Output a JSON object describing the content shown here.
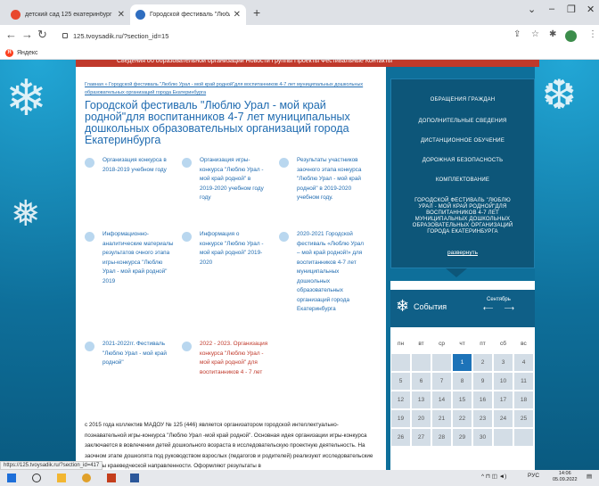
{
  "browser": {
    "tabs": [
      {
        "title": "детский сад 125 екатеринбург",
        "favicon_color": "#e8482e",
        "active": false
      },
      {
        "title": "Городской фестиваль \"Люблю",
        "favicon_color": "#2f6ec0",
        "active": true
      }
    ],
    "new_tab": "+",
    "url": "125.tvoysadik.ru/?section_id=15",
    "bookmark": {
      "icon_letter": "Я",
      "label": "Яндекс"
    },
    "status_url": "https://125.tvoysadik.ru/?section_id=417"
  },
  "page": {
    "top_nav": "Сведения об образовательной организации   Новости   Группы   Проекты   Фестивальные   Контакты",
    "breadcrumb": "Главная » Городской фестиваль \"Люблю Урал - мой край родной\"для воспитанников 4-7 лет муниципальных дошкольных образовательных организаций города Екатеринбурга",
    "title": "Городской фестиваль \"Люблю Урал - мой край родной\"для воспитанников 4-7 лет муниципальных дошкольных образовательных организаций города Екатеринбурга",
    "items": [
      {
        "text": "Организация конкурса в 2018-2019 учебном году",
        "red": false
      },
      {
        "text": "Организация игры-конкурса \"Люблю Урал - мой край родной\" в 2019-2020 учебном году году",
        "red": false
      },
      {
        "text": "Результаты участников заочного этапа конкурса \"Люблю Урал - мой край родной\" в 2019-2020 учебном году.",
        "red": false
      },
      {
        "text": "Информационно-аналитические материалы результатов очного этапа игры-конкурса \"Люблю Урал - мой край родной\" 2019",
        "red": false
      },
      {
        "text": "Информация о конкурсе \"Люблю Урал - мой край родной\" 2019-2020",
        "red": false
      },
      {
        "text": "2020-2021 Городской фестиваль «Люблю Урал – мой край родной!» для воспитанников 4-7 лет муниципальных дошкольных образовательных организаций города Екатеринбурга",
        "red": false
      },
      {
        "text": "2021-2022гг. Фестиваль \"Люблю Урал - мой край родной\"",
        "red": false
      },
      {
        "text": "2022 - 2023. Организация конкурса \"Люблю Урал - мой край родной\" для воспитанников 4 - 7 лет",
        "red": true
      }
    ],
    "body_text": "с 2015 года коллектив МАДОУ № 125 (446) является организатором городской интеллектуально-познавательной игры-конкурса \"Люблю Урал -мой край родной\". Основная идея организации игры-конкурса заключается в вовлечении детей дошкольного возраста в исследовательскую проектную деятельность. На заочном этапе дошколята под руководством взрослых (педагогов и родителей) реализуют исследовательские проекты краеведческой направленности. Оформляют результаты в"
  },
  "side_menu": {
    "items": [
      "ОБРАЩЕНИЯ ГРАЖДАН",
      "ДОПОЛНИТЕЛЬНЫЕ СВЕДЕНИЯ",
      "ДИСТАНЦИОННОЕ ОБУЧЕНИЕ",
      "ДОРОЖНАЯ БЕЗОПАСНОСТЬ",
      "КОМПЛЕКТОВАНИЕ",
      "ГОРОДСКОЙ ФЕСТИВАЛЬ \"ЛЮБЛЮ УРАЛ - МОЙ КРАЙ РОДНОЙ\"ДЛЯ ВОСПИТАННИКОВ 4-7 ЛЕТ МУНИЦИПАЛЬНЫХ ДОШКОЛЬНЫХ ОБРАЗОВАТЕЛЬНЫХ ОРГАНИЗАЦИЙ ГОРОДА ЕКАТЕРИНБУРГА"
    ],
    "expand": "развернуть"
  },
  "calendar": {
    "title": "События",
    "month": "Сентябрь",
    "weekdays": [
      "пн",
      "вт",
      "ср",
      "чт",
      "пт",
      "сб",
      "вс"
    ],
    "weeks": [
      [
        "",
        "",
        "",
        "1",
        "2",
        "3",
        "4"
      ],
      [
        "5",
        "6",
        "7",
        "8",
        "9",
        "10",
        "11"
      ],
      [
        "12",
        "13",
        "14",
        "15",
        "16",
        "17",
        "18"
      ],
      [
        "19",
        "20",
        "21",
        "22",
        "23",
        "24",
        "25"
      ],
      [
        "26",
        "27",
        "28",
        "29",
        "30",
        "",
        ""
      ]
    ],
    "today": "1"
  },
  "taskbar": {
    "tray_lang": "РУС",
    "time": "14:06",
    "date": "05.09.2022"
  },
  "colors": {
    "page_blue": "#0e6f9a",
    "link_blue": "#1f6bb0",
    "accent_red": "#c0392b",
    "calendar_today": "#1d73b8"
  }
}
